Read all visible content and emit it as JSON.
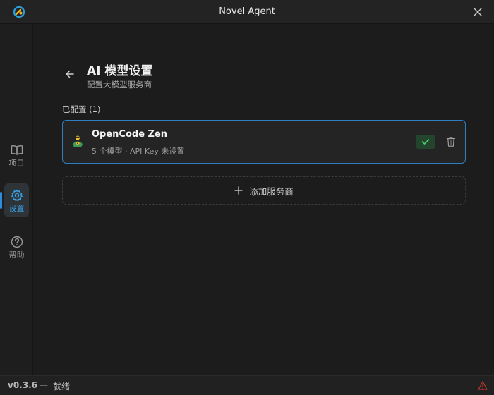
{
  "window": {
    "title": "Novel Agent"
  },
  "sidebar": {
    "items": [
      {
        "label": "项目",
        "icon": "book-icon"
      },
      {
        "label": "设置",
        "icon": "gear-icon"
      },
      {
        "label": "帮助",
        "icon": "help-circle-icon"
      }
    ]
  },
  "page": {
    "title": "AI 模型设置",
    "subtitle": "配置大模型服务商"
  },
  "providers": {
    "section_label": "已配置 (1)",
    "items": [
      {
        "name": "OpenCode Zen",
        "meta": "5 个模型 · API Key 未设置"
      }
    ],
    "add_label": "添加服务商"
  },
  "status": {
    "version": "v0.3.6",
    "separator": "—",
    "text": "就绪"
  },
  "colors": {
    "accent": "#2f7fc0",
    "active_nav": "#3aa0e8",
    "success": "#4ccb6a",
    "warning": "#c0392b"
  }
}
